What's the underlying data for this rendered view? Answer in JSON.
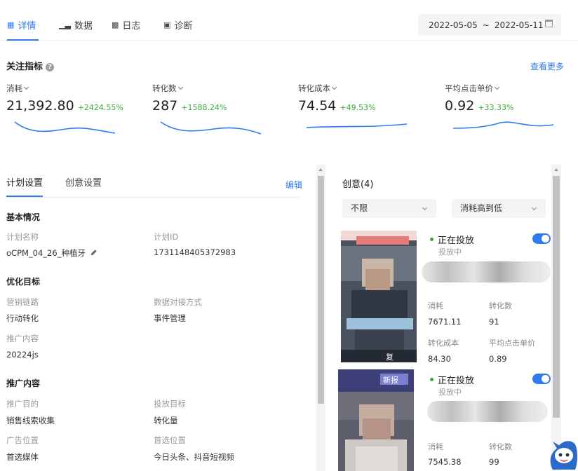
{
  "tabs": [
    {
      "label": "详情",
      "active": true,
      "icon": "detail-icon"
    },
    {
      "label": "数据",
      "active": false,
      "icon": "bar-chart-icon"
    },
    {
      "label": "日志",
      "active": false,
      "icon": "log-icon"
    },
    {
      "label": "诊断",
      "active": false,
      "icon": "diagnose-icon"
    }
  ],
  "date_range": {
    "start": "2022-05-05",
    "separator": "~",
    "end": "2022-05-11"
  },
  "focus": {
    "title": "关注指标",
    "more_link": "查看更多"
  },
  "metrics": [
    {
      "label": "消耗",
      "value": "21,392.80",
      "change": "+2424.55%"
    },
    {
      "label": "转化数",
      "value": "287",
      "change": "+1588.24%"
    },
    {
      "label": "转化成本",
      "value": "74.54",
      "change": "+49.53%"
    },
    {
      "label": "平均点击单价",
      "value": "0.92",
      "change": "+33.33%"
    }
  ],
  "plan": {
    "tabs": [
      "计划设置",
      "创意设置"
    ],
    "edit_link": "编辑",
    "groups": {
      "basic": "基本情况",
      "optimize": "优化目标",
      "promote": "推广内容"
    },
    "fields": {
      "plan_name_label": "计划名称",
      "plan_name_value": "oCPM_04_26_种植牙",
      "plan_id_label": "计划ID",
      "plan_id_value": "1731148405372983",
      "marketing_chain_label": "营销链路",
      "marketing_chain_value": "行动转化",
      "data_integration_label": "数据对接方式",
      "data_integration_value": "事件管理",
      "promote_content_label": "推广内容",
      "promote_content_value": "20224js",
      "promote_purpose_label": "推广目的",
      "promote_purpose_value": "销售线索收集",
      "delivery_target_label": "投放目标",
      "delivery_target_value": "转化量",
      "ad_position_label": "广告位置",
      "ad_position_value": "首选媒体",
      "preferred_position_label": "首选位置",
      "preferred_position_value": "今日头条、抖音短视频"
    }
  },
  "creative": {
    "title": "创意(4)",
    "filter_value": "不限",
    "sort_value": "消耗高到低",
    "cards": [
      {
        "status": "正在投放",
        "substatus": "投放中",
        "thumb_caption": "复",
        "stats": [
          {
            "label": "消耗",
            "value": "7671.11"
          },
          {
            "label": "转化数",
            "value": "91"
          },
          {
            "label": "转化成本",
            "value": "84.30"
          },
          {
            "label": "平均点击单价",
            "value": "0.89"
          }
        ]
      },
      {
        "status": "正在投放",
        "substatus": "投放中",
        "thumb_caption": "新报",
        "stats": [
          {
            "label": "消耗",
            "value": "7545.38"
          },
          {
            "label": "转化数",
            "value": "99"
          }
        ]
      }
    ]
  },
  "colors": {
    "accent": "#2f7bed",
    "positive": "#3daa3a"
  }
}
